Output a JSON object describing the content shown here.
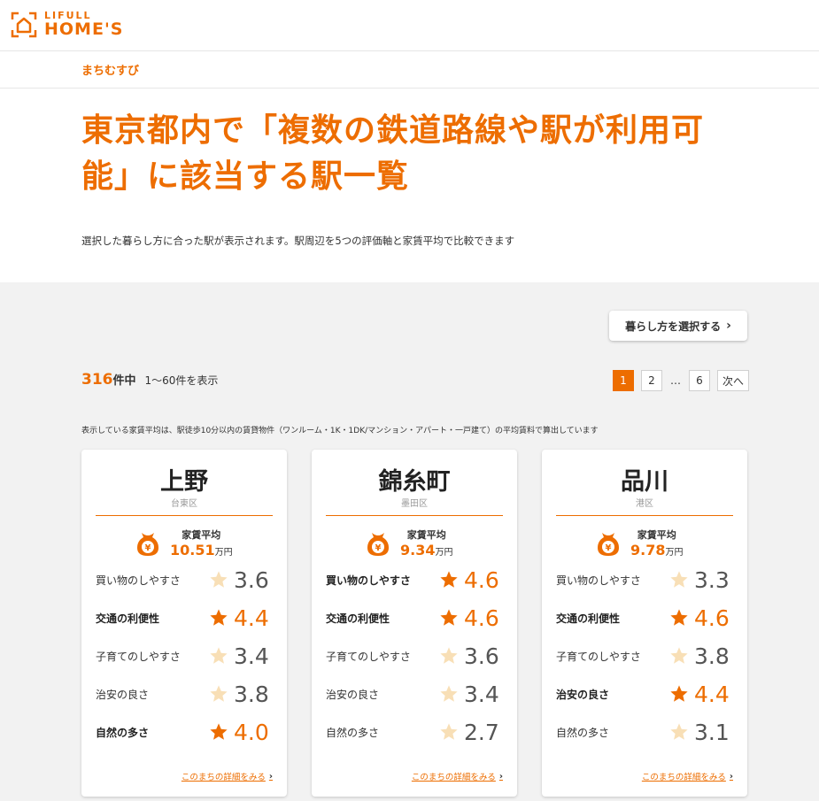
{
  "header": {
    "logo_top": "LIFULL",
    "logo_main": "HOME'S",
    "logo_icon": "house-frame-logo",
    "brand_color": "#ed6d00"
  },
  "subnav": {
    "label": "まちむすび"
  },
  "hero": {
    "title": "東京都内で「複数の鉄道路線や駅が利用可能」に該当する駅一覧",
    "description": "選択した暮らし方に合った駅が表示されます。駅周辺を5つの評価軸と家賃平均で比較できます"
  },
  "controls": {
    "select_button": "暮らし方を選択する",
    "count_num": "316",
    "count_unit": "件中",
    "count_range": "1〜60件を表示",
    "pager": {
      "p1": "1",
      "p2": "2",
      "dots": "…",
      "p6": "6",
      "next": "次へ"
    },
    "note": "表示している家賃平均は、駅徒歩10分以内の賃貸物件（ワンルーム・1K・1DK/マンション・アパート・一戸建て）の平均賃料で算出しています"
  },
  "cards": [
    {
      "name": "上野",
      "ward": "台東区",
      "rent_label": "家賃平均",
      "rent_value": "10.51",
      "rent_unit": "万円",
      "metrics": [
        {
          "label": "買い物のしやすさ",
          "score": "3.6"
        },
        {
          "label": "交通の利便性",
          "score": "4.4"
        },
        {
          "label": "子育てのしやすさ",
          "score": "3.4"
        },
        {
          "label": "治安の良さ",
          "score": "3.8"
        },
        {
          "label": "自然の多さ",
          "score": "4.0"
        }
      ],
      "link": "このまちの詳細をみる"
    },
    {
      "name": "錦糸町",
      "ward": "墨田区",
      "rent_label": "家賃平均",
      "rent_value": "9.34",
      "rent_unit": "万円",
      "metrics": [
        {
          "label": "買い物のしやすさ",
          "score": "4.6"
        },
        {
          "label": "交通の利便性",
          "score": "4.6"
        },
        {
          "label": "子育てのしやすさ",
          "score": "3.6"
        },
        {
          "label": "治安の良さ",
          "score": "3.4"
        },
        {
          "label": "自然の多さ",
          "score": "2.7"
        }
      ],
      "link": "このまちの詳細をみる"
    },
    {
      "name": "品川",
      "ward": "港区",
      "rent_label": "家賃平均",
      "rent_value": "9.78",
      "rent_unit": "万円",
      "metrics": [
        {
          "label": "買い物のしやすさ",
          "score": "3.3"
        },
        {
          "label": "交通の利便性",
          "score": "4.6"
        },
        {
          "label": "子育てのしやすさ",
          "score": "3.8"
        },
        {
          "label": "治安の良さ",
          "score": "4.4"
        },
        {
          "label": "自然の多さ",
          "score": "3.1"
        }
      ],
      "link": "このまちの詳細をみる"
    }
  ],
  "colors": {
    "accent": "#ed6d00",
    "star_dim": "#f8dfb6",
    "bg_main": "#f2f2f2"
  }
}
